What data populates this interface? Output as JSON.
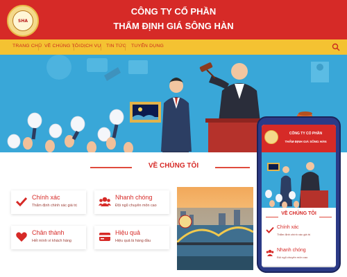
{
  "header": {
    "title_line1": "CÔNG TY CỔ PHẦN",
    "title_line2": "THẨM ĐỊNH GIÁ SÔNG HÀN",
    "logo_text": "SHA"
  },
  "nav": {
    "items": [
      "TRANG CHỦ",
      "VỀ CHÚNG TÔI",
      "DỊCH VỤ",
      "TIN TỨC",
      "TUYỂN DỤNG"
    ],
    "search_icon": "search-icon"
  },
  "section": {
    "title": "VỀ CHÚNG TÔI"
  },
  "features": [
    {
      "title": "Chính xác",
      "subtitle": "Thẩm định chính xác giá trị",
      "icon": "check-icon"
    },
    {
      "title": "Nhanh chóng",
      "subtitle": "Đội ngũ chuyên môn cao",
      "icon": "users-icon"
    },
    {
      "title": "Chân thành",
      "subtitle": "Hết mình vì khách hàng",
      "icon": "heart-icon"
    },
    {
      "title": "Hiệu quả",
      "subtitle": "Hiệu quả là hàng đầu",
      "icon": "card-icon"
    }
  ],
  "phone": {
    "title_line1": "CÔNG TY CỔ PHẦN",
    "title_line2": "THẨM ĐỊNH GIÁ SÔNG HÀN",
    "section_title": "VỀ CHÚNG TÔI",
    "features": [
      {
        "title": "Chính xác",
        "subtitle": "Thẩm định chính xác giá trị"
      },
      {
        "title": "Nhanh chóng",
        "subtitle": "Đội ngũ chuyên môn cao"
      }
    ]
  },
  "colors": {
    "primary_red": "#d62a27",
    "nav_yellow": "#f4c232",
    "hero_blue": "#39a7d8",
    "phone_frame": "#2b3a86"
  }
}
